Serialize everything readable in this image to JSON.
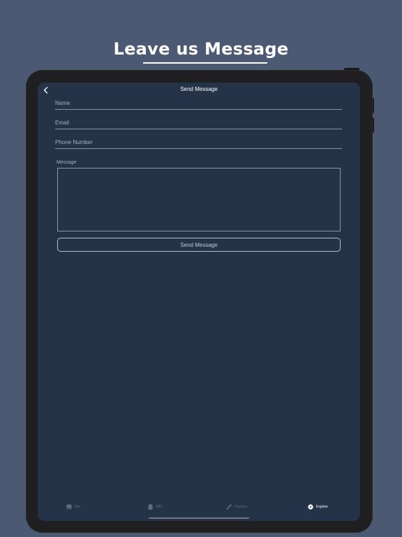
{
  "headline": "Leave us Message",
  "nav": {
    "title": "Send Message"
  },
  "form": {
    "name_placeholder": "Name",
    "email_placeholder": "Email",
    "phone_placeholder": "Phone Number",
    "message_label": "Message",
    "message_value": "",
    "send_label": "Send Message"
  },
  "tabs": [
    {
      "label": "Intri",
      "icon": "bus-icon",
      "active": false
    },
    {
      "label": "ABC",
      "icon": "clipboard-icon",
      "active": false
    },
    {
      "label": "Practice",
      "icon": "pencil-icon",
      "active": false
    },
    {
      "label": "Explore",
      "icon": "compass-icon",
      "active": true
    }
  ],
  "colors": {
    "background": "#4b5a72",
    "screen": "#253349",
    "device": "#1f1f21",
    "active_tab": "#ffffff",
    "inactive_tab": "#5f6c80"
  }
}
